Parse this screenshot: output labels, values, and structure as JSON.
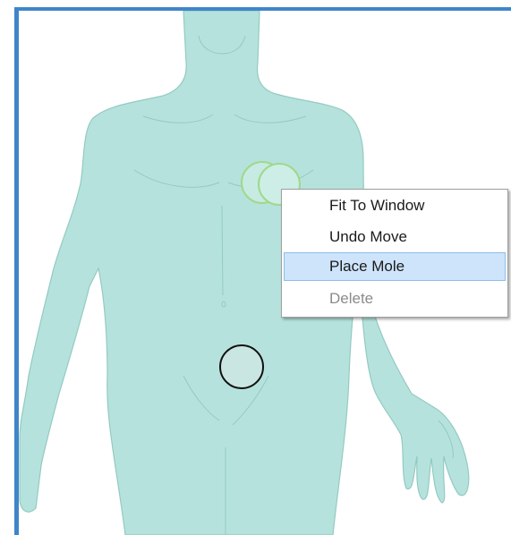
{
  "colors": {
    "body_fill": "#b6e2dd",
    "body_outline": "#93cac2",
    "frame_border": "#3f86c9",
    "mole_ring": "#9fd98a",
    "selected_mole_ring": "#111111",
    "menu_highlight": "#cde4fb"
  },
  "context_menu": {
    "items": [
      {
        "label": "Fit To Window",
        "state": "enabled"
      },
      {
        "label": "Undo Move",
        "state": "enabled"
      },
      {
        "label": "Place Mole",
        "state": "highlighted"
      },
      {
        "label": "Delete",
        "state": "disabled"
      }
    ]
  }
}
